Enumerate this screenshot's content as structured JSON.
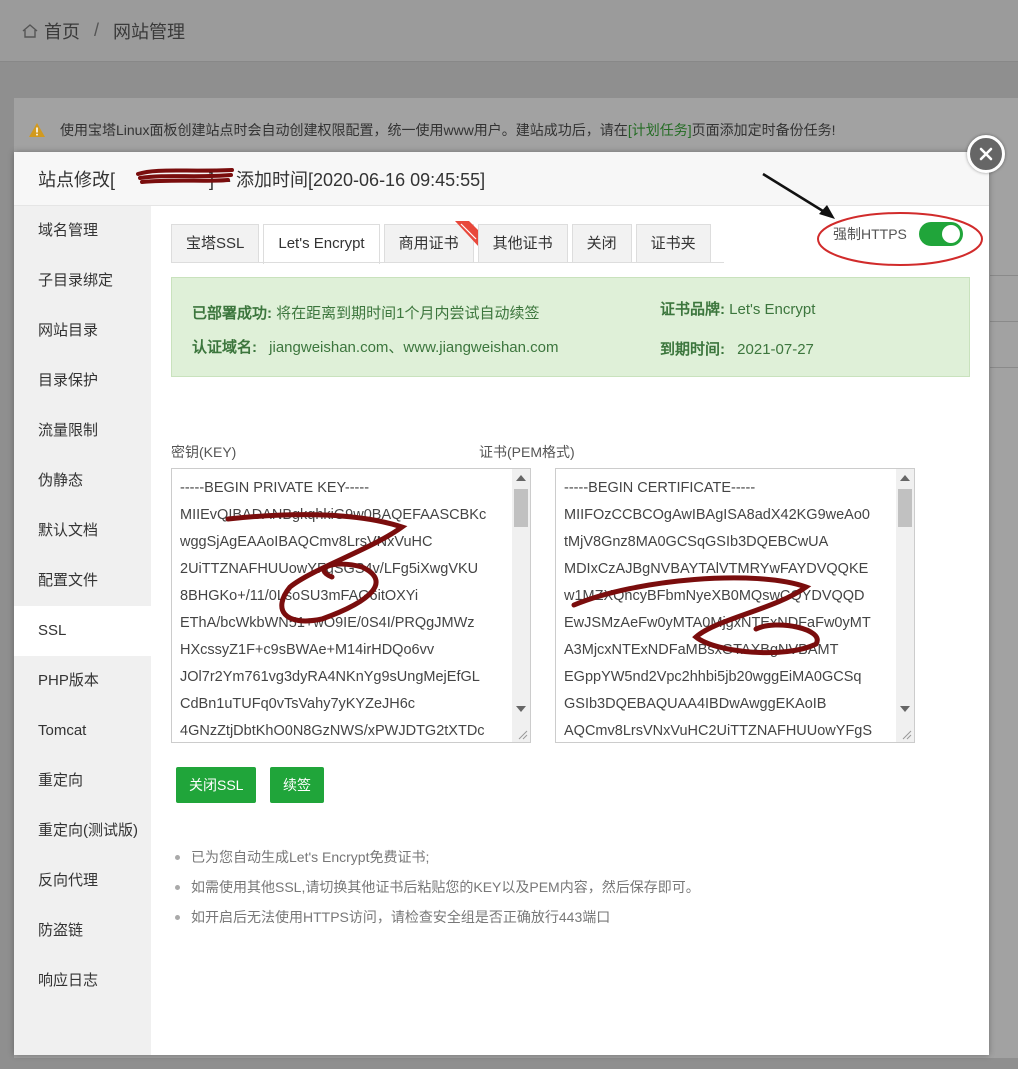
{
  "breadcrumb": {
    "home": "首页",
    "separator": "/",
    "current": "网站管理"
  },
  "notice": {
    "text_before": "使用宝塔Linux面板创建站点时会自动创建权限配置，统一使用www用户。建站成功后，请在",
    "link": "[计划任务]",
    "text_after": "页面添加定时备份任务!"
  },
  "modal": {
    "title_prefix": "站点修改[",
    "title_suffix": "] -- 添加时间[2020-06-16 09:45:55]"
  },
  "sidebar": {
    "items": [
      "域名管理",
      "子目录绑定",
      "网站目录",
      "目录保护",
      "流量限制",
      "伪静态",
      "默认文档",
      "配置文件",
      "SSL",
      "PHP版本",
      "Tomcat",
      "重定向",
      "重定向(测试版)",
      "反向代理",
      "防盗链",
      "响应日志"
    ],
    "active": "SSL"
  },
  "tabs": [
    "宝塔SSL",
    "Let's Encrypt",
    "商用证书",
    "其他证书",
    "关闭",
    "证书夹"
  ],
  "active_tab": "Let's Encrypt",
  "force_https": {
    "label": "强制HTTPS",
    "enabled": true
  },
  "info": {
    "deployed_label": "已部署成功:",
    "deployed_text": "将在距离到期时间1个月内尝试自动续签",
    "domain_label": "认证域名:",
    "domain_value": "jiangweishan.com、www.jiangweishan.com",
    "brand_label": "证书品牌:",
    "brand_value": "Let's Encrypt",
    "expire_label": "到期时间:",
    "expire_value": "2021-07-27"
  },
  "key": {
    "label": "密钥(KEY)",
    "lines": [
      "-----BEGIN PRIVATE KEY-----",
      "MIIEvQIBADANBgkqhkiG9w0BAQEFAASCBKc",
      "wggSjAgEAAoIBAQCmv8LrsVNxVuHC",
      "2UiTTZNAFHUUowYFgSGS4v/LFg5iXwgVKU",
      "8BHGKo+/11/0LsoSU3mFAG6itOXYi",
      "EThA/bcWkbWN51+wO9IE/0S4I/PRQgJMWz",
      "HXcssyZ1F+c9sBWAe+M14irHDQo6vv",
      "JOl7r2Ym761vg3dyRA4NKnYg9sUngMejEfGL",
      "CdBn1uTUFq0vTsVahy7yKYZeJH6c",
      "4GNzZtjDbtKhO0N8GzNWS/xPWJDTG2tXTDc"
    ]
  },
  "cert": {
    "label": "证书(PEM格式)",
    "lines": [
      "-----BEGIN CERTIFICATE-----",
      "MIIFOzCCBCOgAwIBAgISA8adX42KG9weAo0",
      "tMjV8Gnz8MA0GCSqGSIb3DQEBCwUA",
      "MDIxCzAJBgNVBAYTAlVTMRYwFAYDVQQKE",
      "w1MZXQncyBFbmNyeXB0MQswCQYDVQQD",
      "EwJSMzAeFw0yMTA0MjgxNTExNDFaFw0yMT",
      "A3MjcxNTExNDFaMBsxGTAXBgNVBAMT",
      "EGppYW5nd2Vpc2hhbi5jb20wggEiMA0GCSq",
      "GSIb3DQEBAQUAA4IBDwAwggEKAoIB",
      "AQCmv8LrsVNxVuHC2UiTTZNAFHUUowYFgS"
    ]
  },
  "buttons": {
    "close_ssl": "关闭SSL",
    "renew": "续签"
  },
  "notes": [
    "已为您自动生成Let's Encrypt免费证书;",
    "如需使用其他SSL,请切换其他证书后粘贴您的KEY以及PEM内容，然后保存即可。",
    "如开启后无法使用HTTPS访问，请检查安全组是否正确放行443端口"
  ],
  "colors": {
    "accent": "#20a53a",
    "info_bg": "#dff0d8",
    "info_text": "#3c763d",
    "annotation_red": "#d12b2b",
    "scribble": "#7a0d0d"
  }
}
